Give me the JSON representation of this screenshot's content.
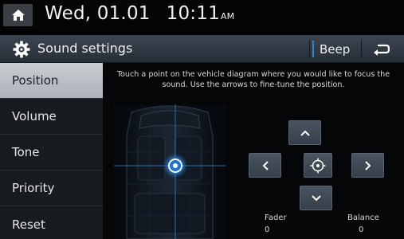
{
  "status": {
    "date": "Wed, 01.01",
    "time": "10:11",
    "ampm": "AM"
  },
  "header": {
    "title": "Sound settings",
    "beep_label": "Beep"
  },
  "sidebar": {
    "items": [
      {
        "label": "Position",
        "active": true
      },
      {
        "label": "Volume",
        "active": false
      },
      {
        "label": "Tone",
        "active": false
      },
      {
        "label": "Priority",
        "active": false
      },
      {
        "label": "Reset",
        "active": false
      }
    ]
  },
  "position": {
    "instruction": "Touch a point on the vehicle diagram where you would like to focus the sound. Use the arrows to fine-tune the position.",
    "fader_label": "Fader",
    "fader_value": "0",
    "balance_label": "Balance",
    "balance_value": "0"
  },
  "icons": {
    "home": "home-icon",
    "settings": "gear-icon",
    "back": "back-arrow-icon",
    "up": "chevron-up-icon",
    "down": "chevron-down-icon",
    "left": "chevron-left-icon",
    "right": "chevron-right-icon",
    "center": "crosshair-icon"
  },
  "colors": {
    "accent": "#2f86d6",
    "active_tab": "#bcc0c6"
  }
}
